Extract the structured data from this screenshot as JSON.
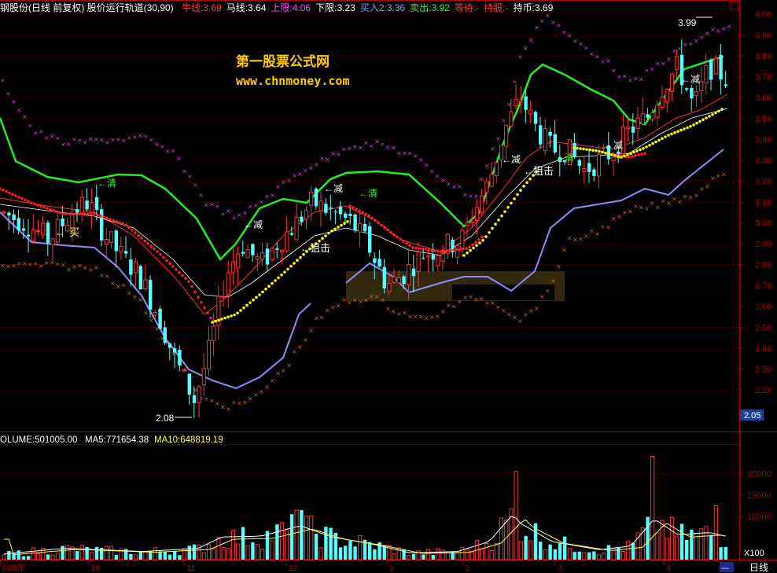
{
  "header": {
    "stock_title": "钢股份(日线 前复权) 股价运行轨道(30,90)",
    "items": [
      {
        "label": "牛线:",
        "value": "3.69",
        "color": "#ff3b3b"
      },
      {
        "label": "马线:",
        "value": "3.64",
        "color": "#ffffff"
      },
      {
        "label": "上限:",
        "value": "4.06",
        "color": "#ff44ff"
      },
      {
        "label": "下限:",
        "value": "3.23",
        "color": "#ffffff"
      },
      {
        "label": "买入",
        "value": "2:3.36",
        "color": "#7fa0ff"
      },
      {
        "label": "卖出:",
        "value": "3.92",
        "color": "#22ff22"
      },
      {
        "label": "等待:",
        "value": "-",
        "color": "#ff3b3b"
      },
      {
        "label": "持股:",
        "value": "-",
        "color": "#ff3b3b"
      },
      {
        "label": "持币:",
        "value": "3.69",
        "color": "#ffffff"
      }
    ]
  },
  "watermark": {
    "line1": "第一股票公式网",
    "line2": "www.chnmoney.com"
  },
  "price_axis": {
    "ticks": [
      "4.00",
      "3.90",
      "3.80",
      "3.70",
      "3.60",
      "3.50",
      "3.40",
      "3.30",
      "3.20",
      "3.10",
      "3.00",
      "2.90",
      "2.80",
      "2.70",
      "2.60",
      "2.50",
      "2.40",
      "2.30",
      "2.20"
    ],
    "min": 2.05,
    "max": 4.0,
    "current_box": "2.05"
  },
  "volume_header": {
    "volume": "OLUME:501005.00",
    "ma5": "MA5:771654.38",
    "ma10": "MA10:648819.19"
  },
  "volume_axis": {
    "ticks": [
      "20000",
      "15000",
      "10000"
    ],
    "unit": "X100",
    "max": 25000
  },
  "date_axis": {
    "labels": [
      "008年",
      "10",
      "11",
      "12",
      "1",
      "2",
      "3",
      "4"
    ],
    "period_tab": "日线",
    "scroll": "---"
  },
  "annotations": {
    "high_label": "3.99",
    "low_label": "2.08",
    "buy": "买",
    "clear1": "清",
    "reduce1": "减",
    "reduce2": "减",
    "clear2": "清",
    "ambush1": "狙击",
    "ambush2": "狙击",
    "reduce3": "减",
    "clear3": "清",
    "reduce4": "减",
    "reduce5": "减"
  },
  "colors": {
    "up": "#ff3333",
    "down": "#54ffff",
    "grid": "#8b0000",
    "axis": "#b00000",
    "green_line": "#22ee22",
    "blue_line": "#8c8cff",
    "red_dots": "#ff2020",
    "yellow_dots": "#ffff00",
    "magenta_x": "#cc44cc",
    "orange_x": "#c07020"
  },
  "chart_data": {
    "type": "line",
    "title": "股价运行轨道(30,90)",
    "price_range": [
      2.05,
      4.0
    ],
    "candles_x_count": 150,
    "key_points": [
      {
        "label": "high",
        "value": 3.99
      },
      {
        "label": "low",
        "value": 2.08
      }
    ],
    "volume_ticks": [
      10000,
      15000,
      20000
    ]
  }
}
